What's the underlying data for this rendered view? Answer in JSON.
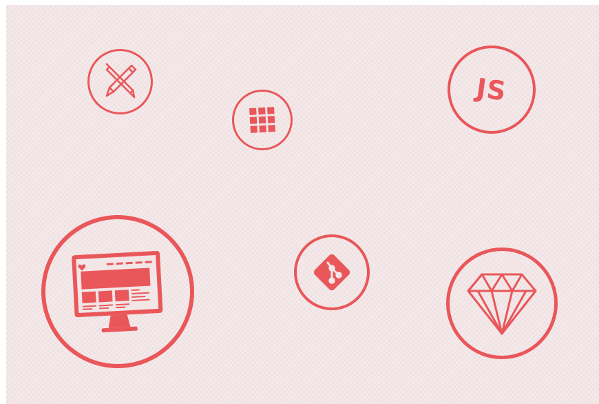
{
  "accent_color": "#e9575a",
  "background_color": "#f3e6e7",
  "badges": {
    "design": {
      "icon": "pencil-pen-cross-icon"
    },
    "grid": {
      "icon": "grid-icon"
    },
    "javascript": {
      "icon": "javascript-icon",
      "label": "JS"
    },
    "desktop": {
      "icon": "desktop-monitor-icon"
    },
    "git": {
      "icon": "git-icon"
    },
    "ruby": {
      "icon": "ruby-diamond-icon"
    }
  }
}
